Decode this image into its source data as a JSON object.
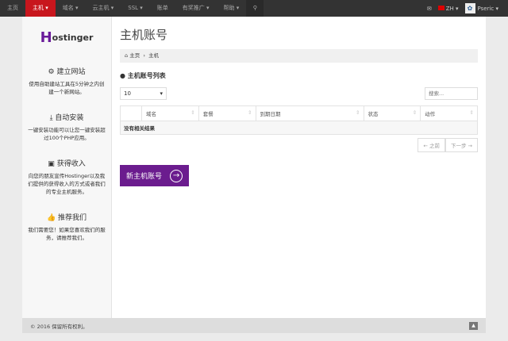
{
  "nav": {
    "items": [
      "主页",
      "主机",
      "域名",
      "云主机",
      "SSL",
      "账单",
      "有奖推广",
      "帮助"
    ],
    "lang": "ZH",
    "user": "Pseric"
  },
  "sidebar": {
    "logo": "Hostinger",
    "blocks": [
      {
        "title": "建立网站",
        "text": "使用自助建站工具在5分钟之内创建一个新网站。"
      },
      {
        "title": "自动安装",
        "text": "一键安装功能可以让您一键安装超过100个PHP应用。"
      },
      {
        "title": "获得收入",
        "text": "向您的朋友宣传Hostinger以及我们提供的获得收入的方式或者我们的专业主机服务。"
      },
      {
        "title": "推荐我们",
        "text": "我们需要您！如果您喜欢我们的服务，请推荐我们。"
      }
    ]
  },
  "main": {
    "title": "主机账号",
    "breadcrumb": [
      "主页",
      "主机"
    ],
    "section": "主机账号列表",
    "page_size": "10",
    "search_placeholder": "搜索...",
    "columns": [
      "",
      "域名",
      "套餐",
      "到期日期",
      "状态",
      "动作"
    ],
    "empty": "没有相关结果",
    "prev": "← 之前",
    "next": "下一步 →",
    "new_button": "新主机账号"
  },
  "footer": {
    "copyright": "© 2016 保留所有权利。"
  }
}
